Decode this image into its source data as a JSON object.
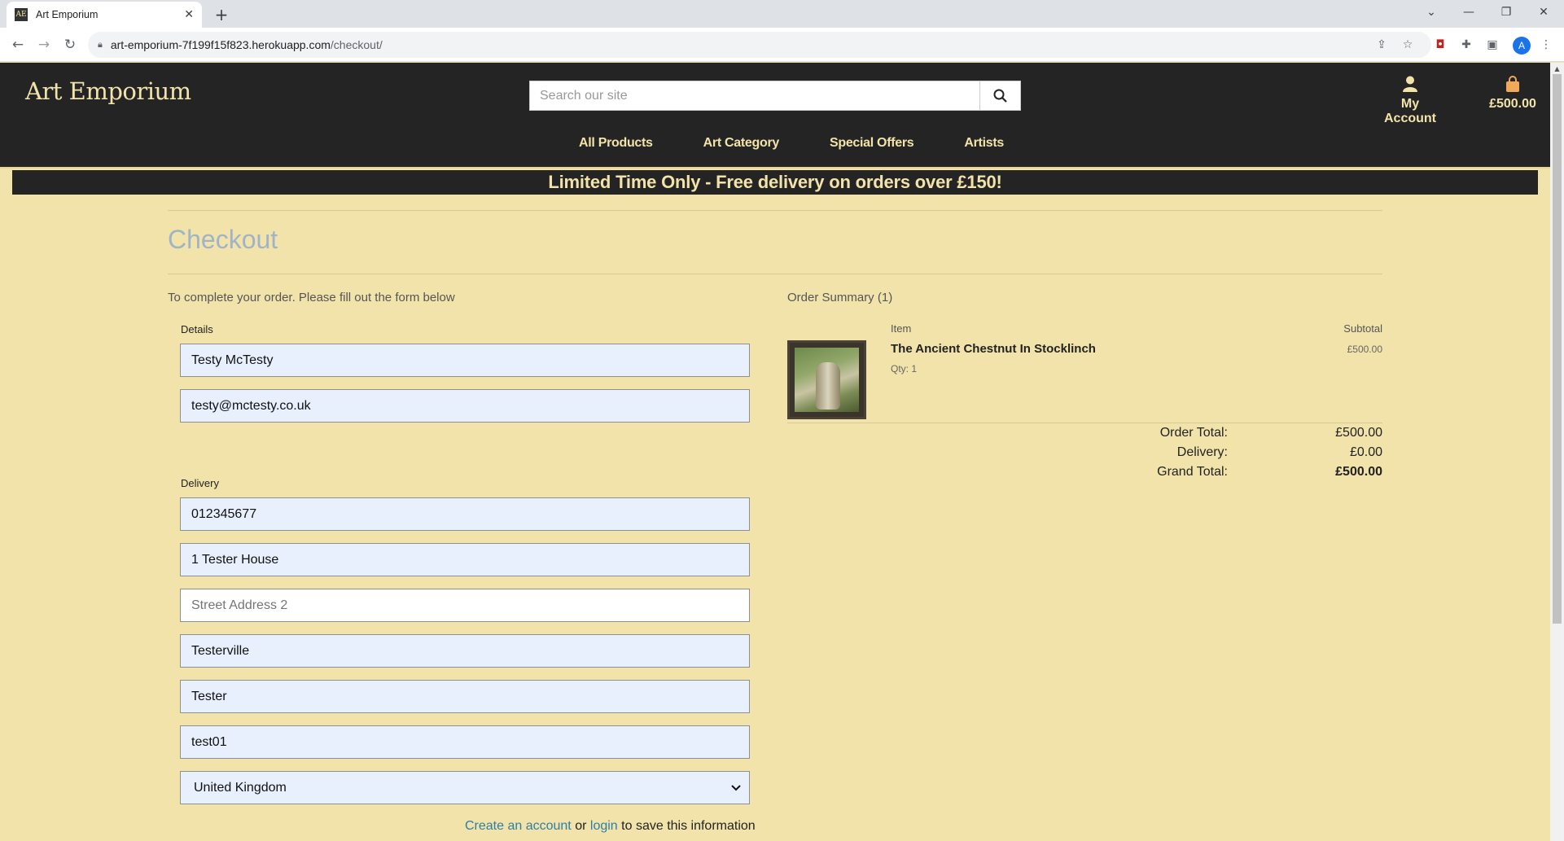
{
  "browser": {
    "tab_title": "Art Emporium",
    "favicon": "AE",
    "url_domain": "art-emporium-7f199f15f823.herokuapp.com",
    "url_path": "/checkout/",
    "profile_initial": "A"
  },
  "header": {
    "logo": "Art Emporium",
    "search_placeholder": "Search our site",
    "account_label": "My Account",
    "bag_total": "£500.00",
    "nav": [
      "All Products",
      "Art Category",
      "Special Offers",
      "Artists"
    ]
  },
  "banner": "Limited Time Only - Free delivery on orders over £150!",
  "checkout": {
    "title": "Checkout",
    "instructions": "To complete your order. Please fill out the form below",
    "details_label": "Details",
    "details": [
      "Testy McTesty",
      "testy@mctesty.co.uk"
    ],
    "delivery_label": "Delivery",
    "delivery": [
      "012345677",
      "1 Tester House",
      "Street Address 2",
      "Testerville",
      "Tester",
      "test01"
    ],
    "country": "United Kingdom",
    "save_note": {
      "create": "Create an account",
      "or": "or",
      "login": "login",
      "rest": "to save this information"
    }
  },
  "summary": {
    "title": "Order Summary (1)",
    "item_header": "Item",
    "subtotal_header": "Subtotal",
    "item_name": "The Ancient Chestnut In Stocklinch",
    "item_qty": "Qty: 1",
    "item_subtotal": "£500.00",
    "order_total_label": "Order Total:",
    "order_total": "£500.00",
    "delivery_label": "Delivery:",
    "delivery": "£0.00",
    "grand_total_label": "Grand Total:",
    "grand_total": "£500.00"
  }
}
